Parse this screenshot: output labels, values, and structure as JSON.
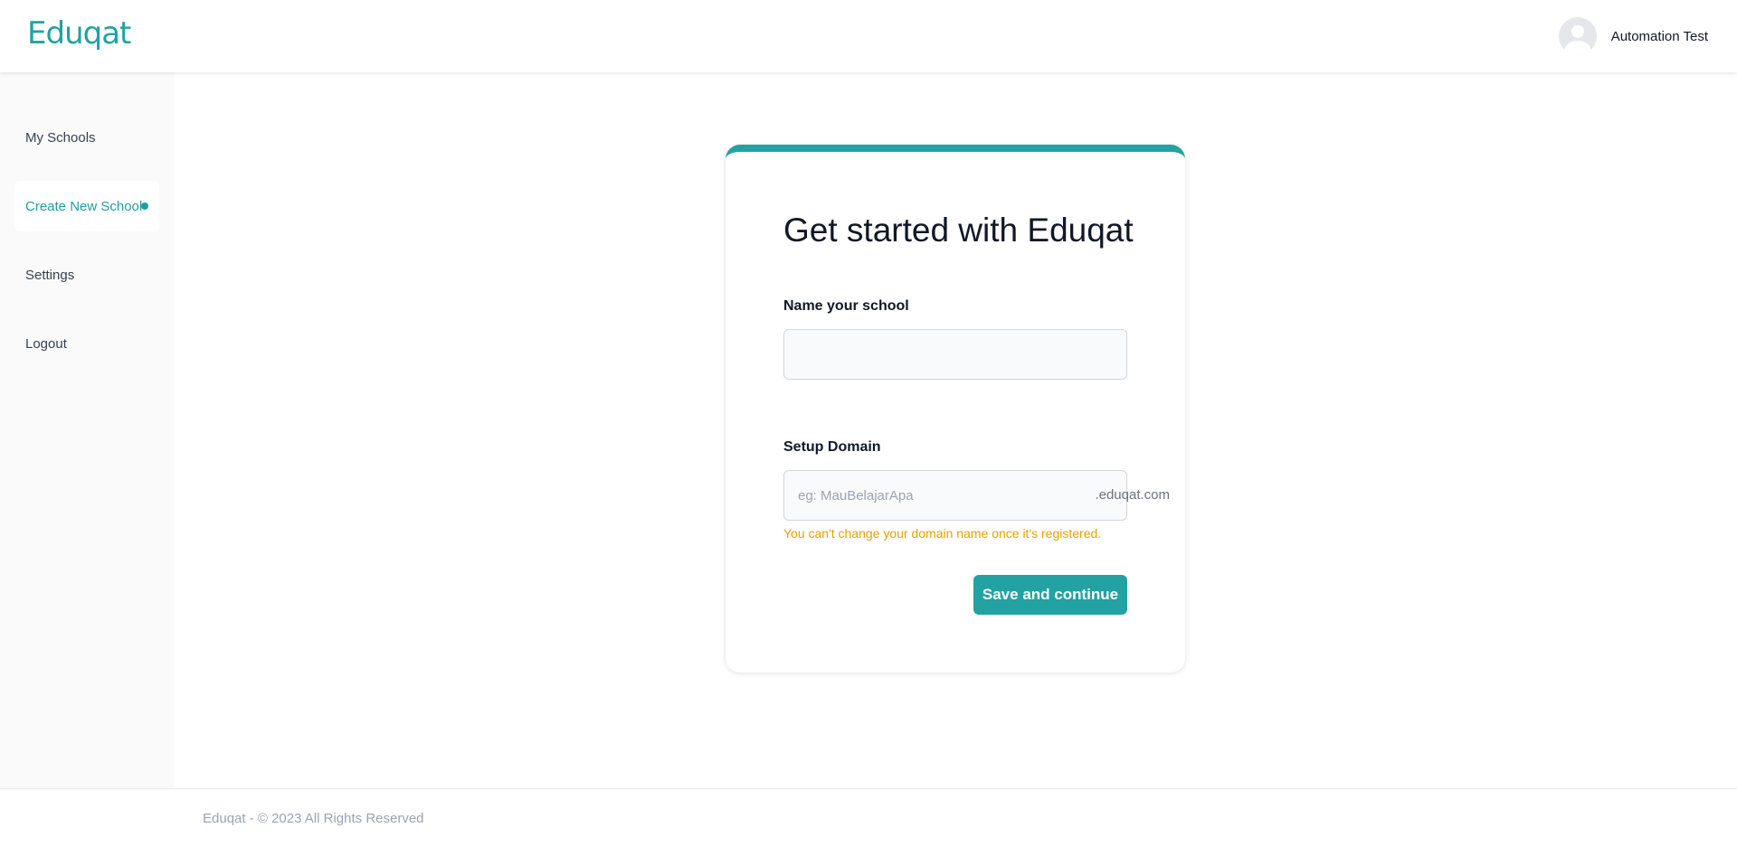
{
  "brand": {
    "logo_text": "Eduqat",
    "accent_color": "#22a2a2"
  },
  "header": {
    "user_name": "Automation Test",
    "avatar_icon": "user-avatar-icon"
  },
  "sidebar": {
    "items": [
      {
        "label": "My Schools",
        "active": false
      },
      {
        "label": "Create New School",
        "active": true
      },
      {
        "label": "Settings",
        "active": false
      },
      {
        "label": "Logout",
        "active": false
      }
    ]
  },
  "form": {
    "title": "Get started with Eduqat",
    "school_name": {
      "label": "Name your school",
      "value": "",
      "placeholder": ""
    },
    "domain": {
      "label": "Setup Domain",
      "value": "",
      "placeholder": "eg: MauBelajarApa",
      "suffix": ".eduqat.com",
      "warning": "You can't change your domain name once it's registered.",
      "warning_color": "#e6a100"
    },
    "submit_label": "Save and continue"
  },
  "footer": {
    "text": "Eduqat - © 2023 All Rights Reserved"
  }
}
